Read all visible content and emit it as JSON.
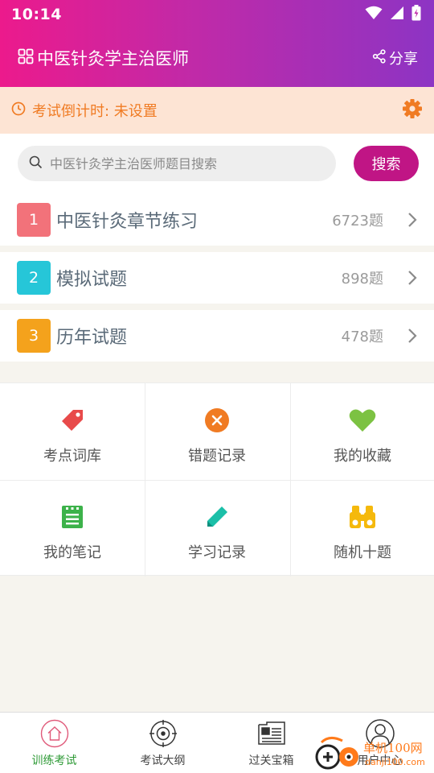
{
  "status_bar": {
    "time": "10:14"
  },
  "header": {
    "title": "中医针灸学主治医师",
    "share_label": "分享"
  },
  "countdown": {
    "text": "考试倒计时: 未设置"
  },
  "search": {
    "placeholder": "中医针灸学主治医师题目搜索",
    "value": "",
    "button_label": "搜索"
  },
  "categories": [
    {
      "num": "1",
      "name": "中医针灸章节练习",
      "count": "6723题",
      "color": "#f2727a"
    },
    {
      "num": "2",
      "name": "模拟试题",
      "count": "898题",
      "color": "#26c6d8"
    },
    {
      "num": "3",
      "name": "历年试题",
      "count": "478题",
      "color": "#f4a21c"
    }
  ],
  "grid": [
    {
      "label": "考点词库",
      "icon": "tag-icon",
      "color": "#e84a4a"
    },
    {
      "label": "错题记录",
      "icon": "close-circle-icon",
      "color": "#f07b23"
    },
    {
      "label": "我的收藏",
      "icon": "heart-icon",
      "color": "#7cc242"
    },
    {
      "label": "我的笔记",
      "icon": "notebook-icon",
      "color": "#3cb24a"
    },
    {
      "label": "学习记录",
      "icon": "pencil-icon",
      "color": "#1bbfa8"
    },
    {
      "label": "随机十题",
      "icon": "binoculars-icon",
      "color": "#f5b90c"
    }
  ],
  "tabs": [
    {
      "label": "训练考试",
      "icon": "home-icon",
      "active": true
    },
    {
      "label": "考试大纲",
      "icon": "target-icon",
      "active": false
    },
    {
      "label": "过关宝箱",
      "icon": "newspaper-icon",
      "active": false
    },
    {
      "label": "用户中心",
      "icon": "user-icon",
      "active": false
    }
  ],
  "watermark": {
    "text": "单机100网",
    "url": "danji100.com"
  },
  "colors": {
    "accent": "#c01585",
    "countdown_bg": "#fde4d4",
    "countdown_text": "#f07b23",
    "tab_active": "#2e9a36"
  }
}
